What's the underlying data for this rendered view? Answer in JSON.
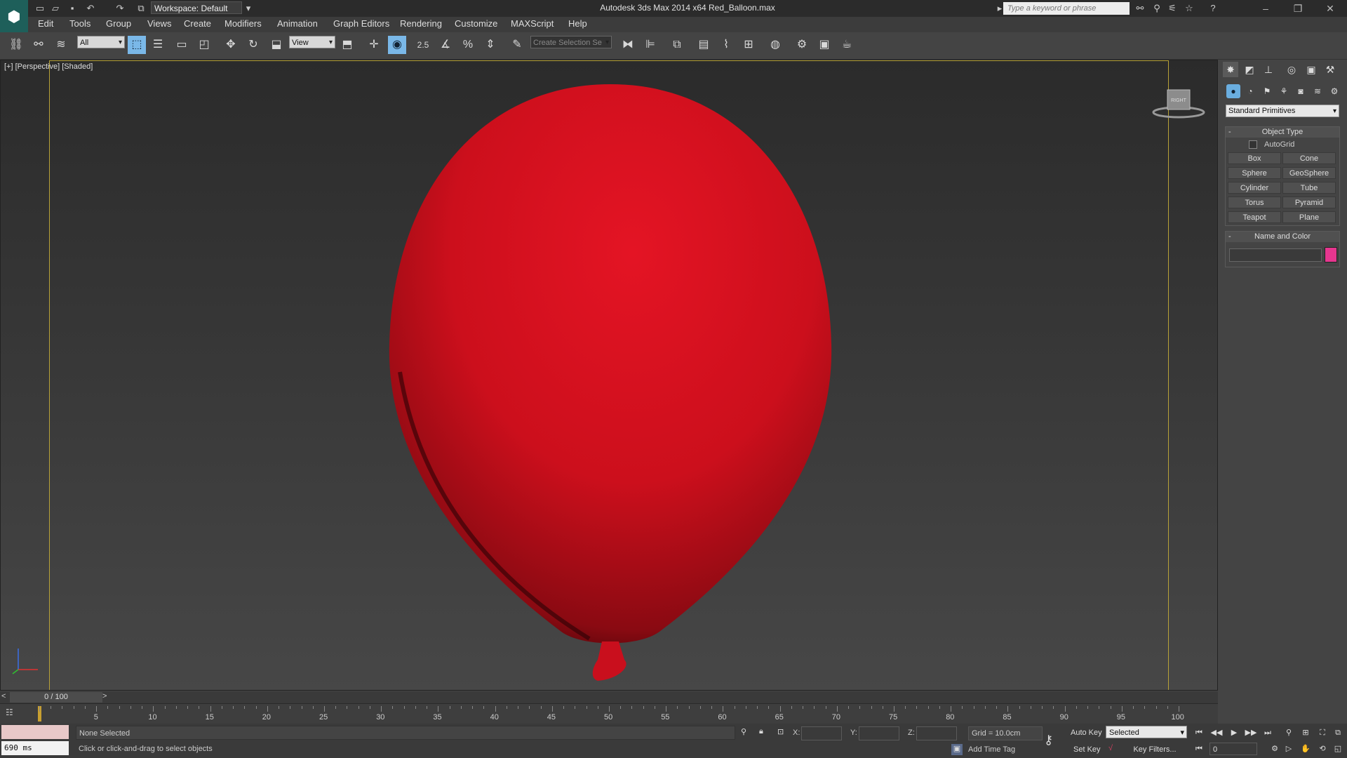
{
  "title_bar": {
    "workspace": "Workspace: Default",
    "app_title": "Autodesk 3ds Max  2014 x64     Red_Balloon.max",
    "search_placeholder": "Type a keyword or phrase"
  },
  "menu": [
    "Edit",
    "Tools",
    "Group",
    "Views",
    "Create",
    "Modifiers",
    "Animation",
    "Graph Editors",
    "Rendering",
    "Customize",
    "MAXScript",
    "Help"
  ],
  "toolbar": {
    "selection_filter": "All",
    "reference_coord": "View",
    "snap_value": "2.5",
    "named_selection": "Create Selection Se"
  },
  "viewport": {
    "label": "[+] [Perspective] [Shaded]",
    "viewcube_label": "RIGHT",
    "object_color": "#d8111f"
  },
  "command_panel": {
    "category": "Standard Primitives",
    "object_type": {
      "title": "Object Type",
      "autogrid": "AutoGrid",
      "buttons": [
        "Box",
        "Cone",
        "Sphere",
        "GeoSphere",
        "Cylinder",
        "Tube",
        "Torus",
        "Pyramid",
        "Teapot",
        "Plane"
      ]
    },
    "name_and_color": {
      "title": "Name and Color",
      "swatch_color": "#e7368f"
    }
  },
  "time_slider": {
    "frame": "0 / 100",
    "prev": "<",
    "next": ">",
    "ticks": [
      "5",
      "10",
      "15",
      "20",
      "25",
      "30",
      "35",
      "40",
      "45",
      "50",
      "55",
      "60",
      "65",
      "70",
      "75",
      "80",
      "85",
      "90",
      "95",
      "100"
    ]
  },
  "status": {
    "ms": "690 ms",
    "selection": "None Selected",
    "prompt": "Click or click-and-drag to select objects",
    "x_label": "X:",
    "y_label": "Y:",
    "z_label": "Z:",
    "grid": "Grid = 10.0cm",
    "add_time_tag": "Add Time Tag",
    "auto_key": "Auto Key",
    "set_key": "Set Key",
    "auto_key_mode": "Selected",
    "key_filters": "Key Filters...",
    "current_frame": "0"
  }
}
